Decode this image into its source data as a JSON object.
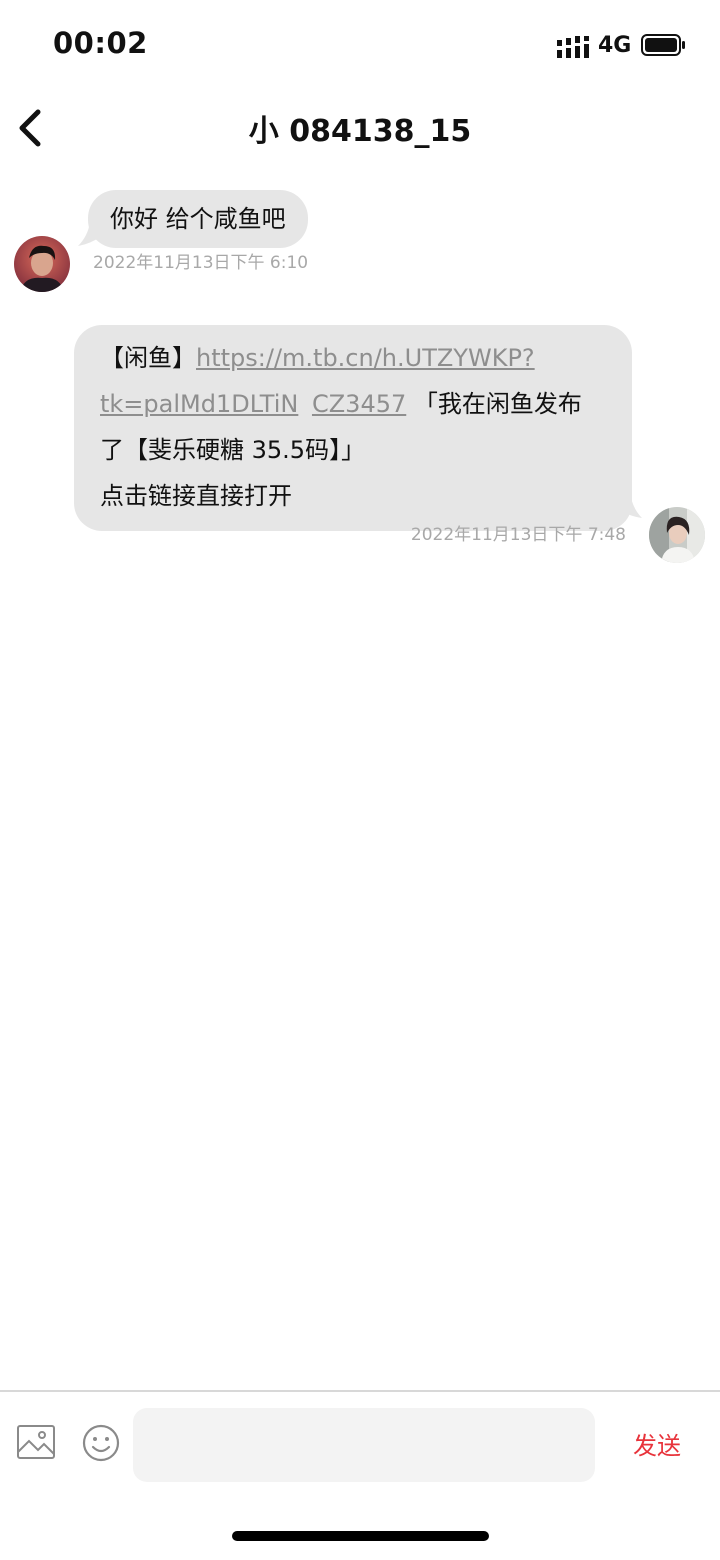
{
  "status_bar": {
    "time": "00:02",
    "network": "4G"
  },
  "header": {
    "title": "小 084138_15"
  },
  "messages": [
    {
      "direction": "incoming",
      "text": "你好 给个咸鱼吧",
      "timestamp": "2022年11月13日下午 6:10"
    },
    {
      "direction": "outgoing",
      "prefix": "【闲鱼】",
      "link_line1": "https://m.tb.cn/h.UTZYWKP?",
      "link_line2": "tk=palMd1DLTiN",
      "code": "CZ3457",
      "text_line2_tail": " 「我在闲鱼发布",
      "text_line3": "了【斐乐硬糖 35.5码】」",
      "text_line4": "点击链接直接打开",
      "timestamp": "2022年11月13日下午 7:48"
    }
  ],
  "input_bar": {
    "placeholder": "",
    "send_label": "发送"
  }
}
